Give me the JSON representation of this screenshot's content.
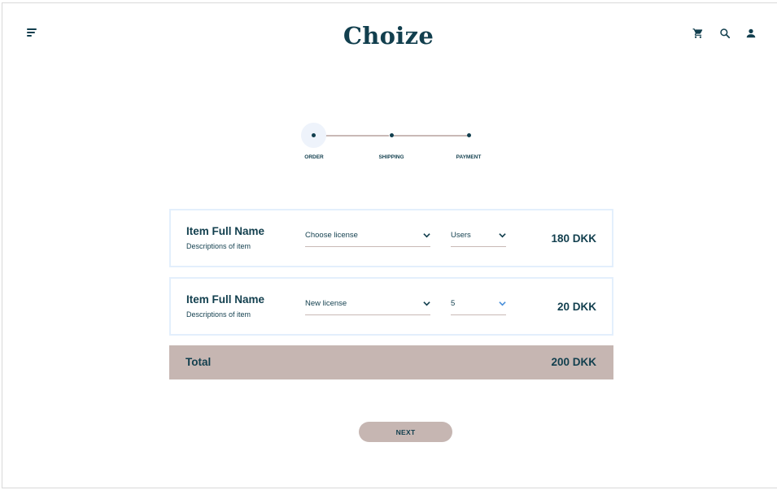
{
  "header": {
    "logo": "Choize",
    "icons": [
      "menu-icon",
      "cart-icon",
      "search-icon",
      "user-icon"
    ]
  },
  "stepper": {
    "steps": [
      {
        "label": "ORDER",
        "active": true
      },
      {
        "label": "SHIPPING",
        "active": false
      },
      {
        "label": "PAYMENT",
        "active": false
      }
    ]
  },
  "items": [
    {
      "name": "Item Full Name",
      "description": "Descriptions of item",
      "license": "Choose license",
      "users": "Users",
      "price": "180 DKK"
    },
    {
      "name": "Item Full Name",
      "description": "Descriptions of item",
      "license": "New license",
      "users": "5",
      "price": "20 DKK"
    }
  ],
  "total": {
    "label": "Total",
    "value": "200 DKK"
  },
  "next_button": {
    "label": "NEXT"
  },
  "colors": {
    "primary": "#123f4e",
    "accent_taupe": "#c6b6b2",
    "card_border": "#e3effc",
    "step_halo": "#eef3fb",
    "chevron_active": "#4a8fd9"
  }
}
